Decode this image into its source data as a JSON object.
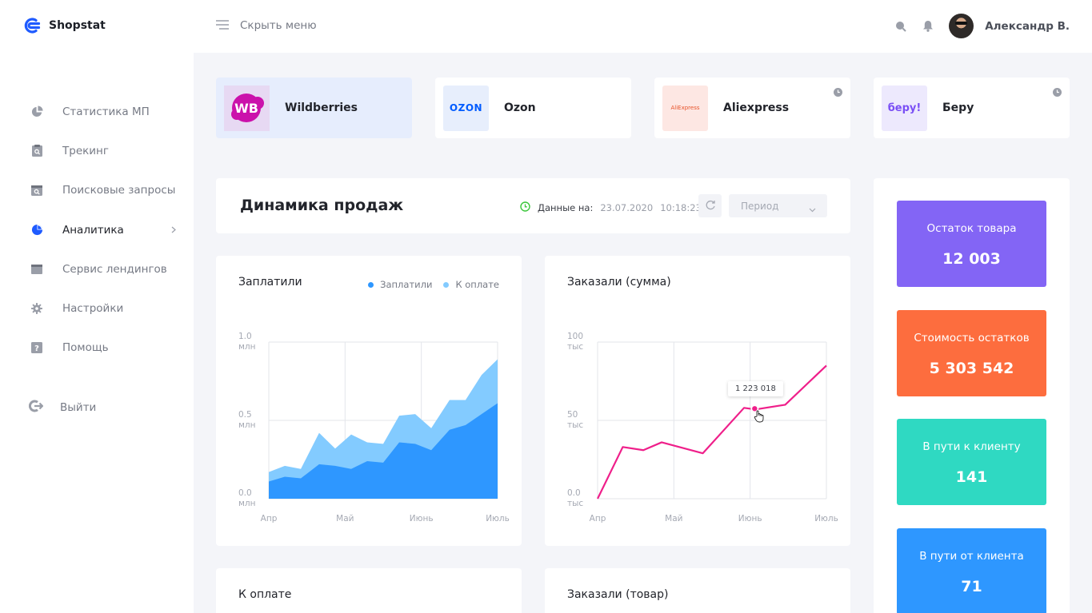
{
  "brand": {
    "name": "Shopstat",
    "accent": "#1f5bff"
  },
  "sidebar": {
    "items": [
      {
        "label": "Статистика МП",
        "icon": "pie-chart-icon"
      },
      {
        "label": "Трекинг",
        "icon": "tracking-icon"
      },
      {
        "label": "Поисковые запросы",
        "icon": "search-queries-icon"
      },
      {
        "label": "Аналитика",
        "icon": "analytics-icon",
        "active": true
      },
      {
        "label": "Сервис лендингов",
        "icon": "landing-icon"
      },
      {
        "label": "Настройки",
        "icon": "gear-icon"
      },
      {
        "label": "Помощь",
        "icon": "help-icon"
      }
    ],
    "logout": "Выйти"
  },
  "topbar": {
    "menu_toggle": "Скрыть меню",
    "user_name": "Александр В."
  },
  "marketplaces": [
    {
      "name": "Wildberries",
      "logo_text": "WB",
      "active": true
    },
    {
      "name": "Ozon",
      "logo_text": "OZON"
    },
    {
      "name": "Aliexpress",
      "logo_text": "AliExpress"
    },
    {
      "name": "Беру",
      "logo_text": "беру!"
    }
  ],
  "dynamics": {
    "title": "Динамика продаж",
    "data_on_label": "Данные на:",
    "date": "23.07.2020",
    "time": "10:18:23",
    "period_placeholder": "Период"
  },
  "charts": {
    "paid": {
      "title": "Заплатили",
      "legend": [
        "Заплатили",
        "К оплате"
      ],
      "y_ticks": [
        [
          "1.0",
          "млн"
        ],
        [
          "0.5",
          "млн"
        ],
        [
          "0.0",
          "млн"
        ]
      ],
      "x_ticks": [
        "Апр",
        "Май",
        "Июнь",
        "Июль"
      ]
    },
    "ordered_sum": {
      "title": "Заказали (сумма)",
      "y_ticks": [
        [
          "100",
          "тыс"
        ],
        [
          "50",
          "тыс"
        ],
        [
          "0.0",
          "тыс"
        ]
      ],
      "x_ticks": [
        "Апр",
        "Май",
        "Июнь",
        "Июль"
      ],
      "tooltip": "1 223 018"
    },
    "to_pay": {
      "title": "К оплате"
    },
    "ordered_goods": {
      "title": "Заказали (товар)"
    }
  },
  "chart_data": [
    {
      "type": "area",
      "title": "Заплатили",
      "categories": [
        "Апр",
        "Май",
        "Июнь",
        "Июль"
      ],
      "ylim": [
        0,
        1.0
      ],
      "x": [
        0,
        0.07,
        0.14,
        0.22,
        0.29,
        0.36,
        0.43,
        0.5,
        0.57,
        0.64,
        0.71,
        0.79,
        0.86,
        0.93,
        1.0
      ],
      "series": [
        {
          "name": "Заплатили",
          "color": "#2e97ff",
          "values": [
            0.11,
            0.14,
            0.13,
            0.22,
            0.21,
            0.19,
            0.24,
            0.23,
            0.36,
            0.35,
            0.31,
            0.44,
            0.47,
            0.54,
            0.61
          ]
        },
        {
          "name": "К оплате",
          "color": "#83cbff",
          "values": [
            0.17,
            0.21,
            0.19,
            0.42,
            0.32,
            0.41,
            0.36,
            0.35,
            0.53,
            0.54,
            0.45,
            0.63,
            0.63,
            0.79,
            0.89
          ]
        }
      ],
      "grid": true
    },
    {
      "type": "line",
      "title": "Заказали (сумма)",
      "categories": [
        "Апр",
        "Май",
        "Июнь",
        "Июль"
      ],
      "ylim": [
        0,
        100
      ],
      "x": [
        0,
        0.11,
        0.2,
        0.28,
        0.46,
        0.64,
        0.69,
        0.82,
        1.0
      ],
      "series": [
        {
          "name": "Заказали (сумма)",
          "color": "#ef1f8a",
          "values": [
            0,
            33,
            31,
            36,
            29,
            58,
            57,
            60,
            85
          ]
        }
      ],
      "grid": true
    }
  ],
  "stats": [
    {
      "label": "Остаток товара",
      "value": "12 003",
      "color": "#8365f5"
    },
    {
      "label": "Стоимость остатков",
      "value": "5 303 542",
      "color": "#fd6d3e"
    },
    {
      "label": "В пути к клиенту",
      "value": "141",
      "color": "#2fd9c2"
    },
    {
      "label": "В пути от клиента",
      "value": "71",
      "color": "#2e97ff"
    }
  ]
}
